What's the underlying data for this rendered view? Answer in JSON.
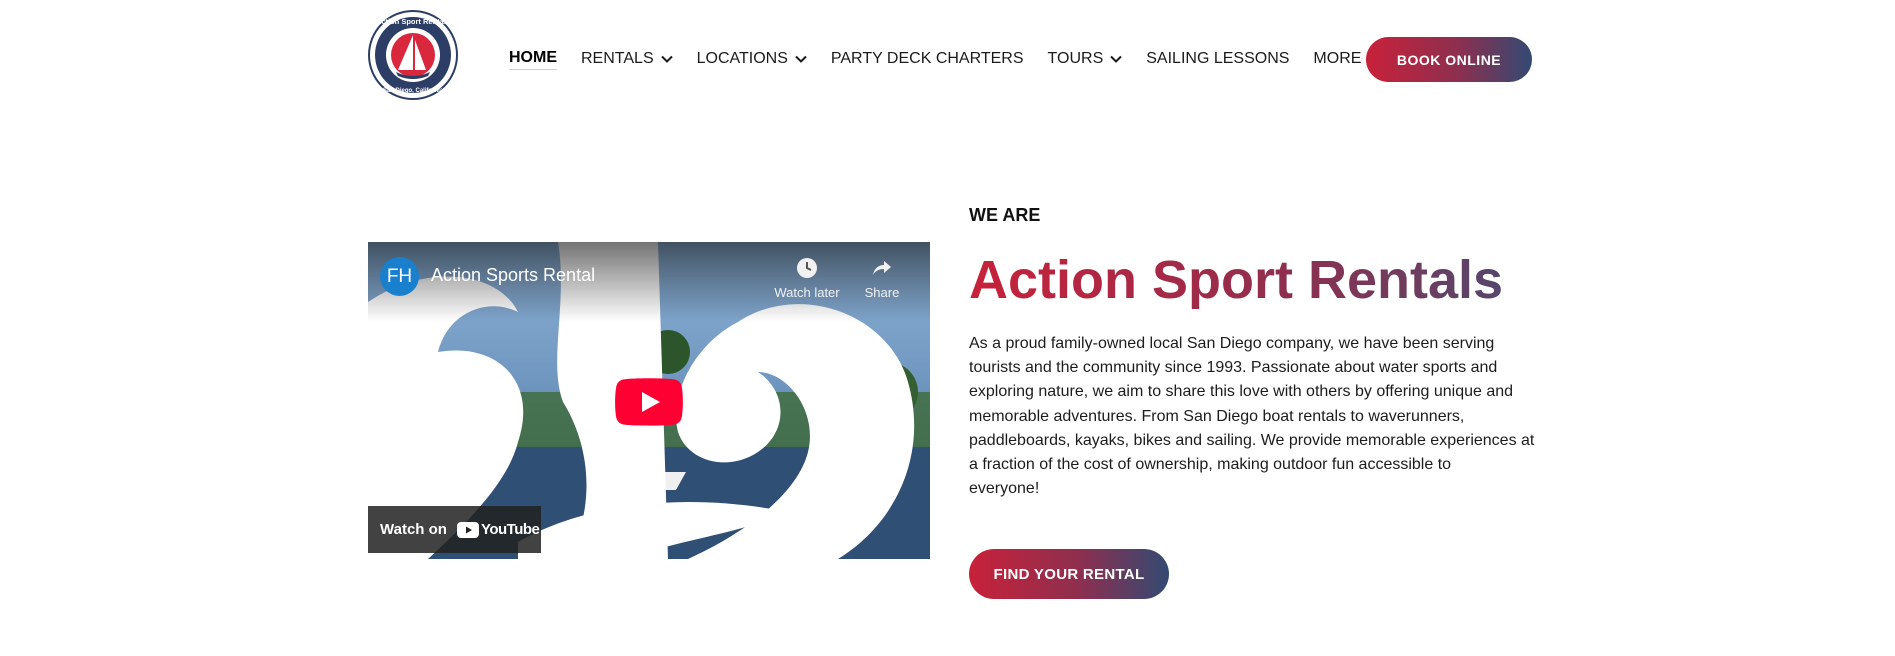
{
  "brand": {
    "logo_top_text": "Action Sport Rentals",
    "logo_bottom_text": "San Diego, California",
    "primary_red": "#c8213a",
    "primary_navy": "#324a73"
  },
  "nav": {
    "items": [
      {
        "label": "HOME",
        "active": true,
        "dropdown": false
      },
      {
        "label": "RENTALS",
        "active": false,
        "dropdown": true
      },
      {
        "label": "LOCATIONS",
        "active": false,
        "dropdown": true
      },
      {
        "label": "PARTY DECK CHARTERS",
        "active": false,
        "dropdown": false
      },
      {
        "label": "TOURS",
        "active": false,
        "dropdown": true
      },
      {
        "label": "SAILING LESSONS",
        "active": false,
        "dropdown": false
      },
      {
        "label": "MORE",
        "active": false,
        "dropdown": true
      }
    ],
    "book_label": "BOOK ONLINE"
  },
  "video": {
    "channel_initials": "FH",
    "title": "Action Sports Rental",
    "watch_later": "Watch later",
    "share": "Share",
    "watch_on": "Watch on",
    "platform": "YouTube"
  },
  "hero": {
    "eyebrow": "WE ARE",
    "headline": "Action Sport Rentals",
    "paragraph_lines": [
      "As a proud family-owned local San Diego company, we have been serving",
      "tourists and the community since 1993. Passionate about water sports and",
      "exploring nature, we aim to share this love with others by offering unique and",
      "memorable adventures. From San Diego boat rentals to waverunners,",
      "paddleboards, kayaks, bikes and sailing. We provide memorable experiences at",
      "a fraction of the cost of ownership, making outdoor fun accessible to",
      "everyone!"
    ],
    "cta_label": "FIND YOUR RENTAL"
  }
}
